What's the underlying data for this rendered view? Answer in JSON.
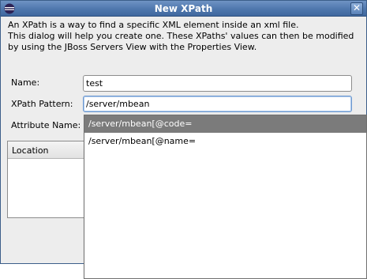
{
  "window": {
    "title": "New XPath",
    "close_glyph": "✕"
  },
  "description": {
    "lines": [
      "An XPath is a way to find a specific XML element inside an xml file.",
      "This dialog will help you create one. These XPaths' values can then be modified",
      "by using the JBoss Servers View with the Properties View."
    ]
  },
  "form": {
    "name_label": "Name:",
    "name_value": "test",
    "xpath_label": "XPath Pattern:",
    "xpath_value": "/server/mbean",
    "attribute_label": "Attribute Name:"
  },
  "table": {
    "columns": [
      "Location"
    ]
  },
  "autocomplete": {
    "items": [
      {
        "label": "/server/mbean[@code=",
        "selected": true
      },
      {
        "label": "/server/mbean[@name=",
        "selected": false
      }
    ]
  },
  "colors": {
    "titlebar": "#4f77ad",
    "selection": "#7b7b7b",
    "dialog_bg": "#ededed"
  },
  "icons": {
    "app": "eclipse-icon",
    "close": "close-icon"
  }
}
